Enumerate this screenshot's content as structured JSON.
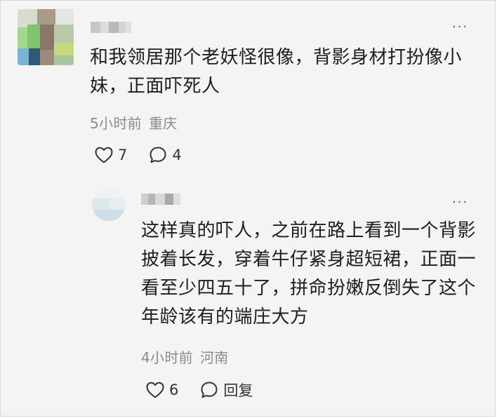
{
  "comments": [
    {
      "more_glyph": "···",
      "text": "和我领居那个老妖怪很像，背影身材打扮像小妹，正面吓死人",
      "time": "5小时前",
      "location": "重庆",
      "likes": "7",
      "replies": "4"
    },
    {
      "more_glyph": "···",
      "text": "这样真的吓人，之前在路上看到一个背影披着长发，穿着牛仔紧身超短裙，正面一看至少四五十了，拼命扮嫩反倒失了这个年龄该有的端庄大方",
      "time": "4小时前",
      "location": "河南",
      "likes": "6",
      "reply_label": "回复"
    }
  ],
  "icons": {
    "like": "heart-outline-icon",
    "comment": "speech-bubble-icon",
    "more": "more-dots-icon"
  },
  "colors": {
    "background": "#f4f4f4",
    "text": "#1e1e1e",
    "meta": "#8a8a8a"
  }
}
